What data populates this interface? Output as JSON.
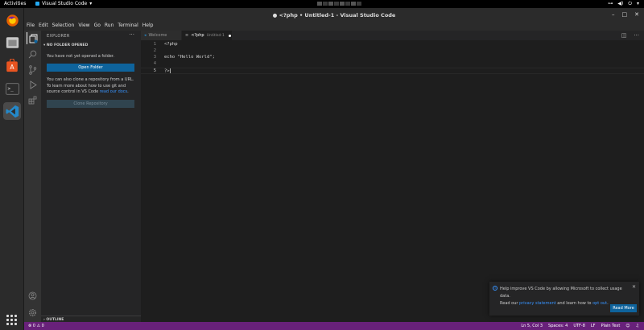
{
  "topbar": {
    "activities": "Activities",
    "app_name": "Visual Studio Code"
  },
  "window": {
    "title": "● <?php • Untitled-1 - Visual Studio Code"
  },
  "menu": [
    "File",
    "Edit",
    "Selection",
    "View",
    "Go",
    "Run",
    "Terminal",
    "Help"
  ],
  "sidebar": {
    "header": "EXPLORER",
    "section": "NO FOLDER OPENED",
    "no_folder_text": "You have not yet opened a folder.",
    "open_folder_label": "Open Folder",
    "clone_text": "You can also clone a repository from a URL. To learn more about how to use git and source control in VS Code ",
    "clone_link": "read our docs",
    "clone_text_end": ".",
    "clone_button_label": "Clone Repository",
    "outline_label": "OUTLINE"
  },
  "tabs": [
    {
      "label": "Welcome"
    },
    {
      "label": "<?php",
      "sub": "Untitled-1"
    }
  ],
  "editor": {
    "lines": [
      {
        "num": "1",
        "code": "<?php"
      },
      {
        "num": "2",
        "code": ""
      },
      {
        "num": "3",
        "code": "echo \"Hello World\";"
      },
      {
        "num": "4",
        "code": ""
      },
      {
        "num": "5",
        "code": "?>"
      }
    ]
  },
  "notification": {
    "line1": "Help improve VS Code by allowing Microsoft to collect usage data.",
    "line2_pre": "Read our ",
    "privacy_link": "privacy statement",
    "line2_mid": " and learn how to ",
    "opt_out_link": "opt out",
    "line2_end": ".",
    "read_more_label": "Read More"
  },
  "status": {
    "errors": "0",
    "warnings": "0",
    "position": "Ln 5, Col 3",
    "spaces": "Spaces: 4",
    "encoding": "UTF-8",
    "eol": "LF",
    "language": "Plain Text"
  },
  "colors": {
    "status_bar": "#68217a",
    "accent": "#0e639c",
    "link": "#3794ff"
  }
}
